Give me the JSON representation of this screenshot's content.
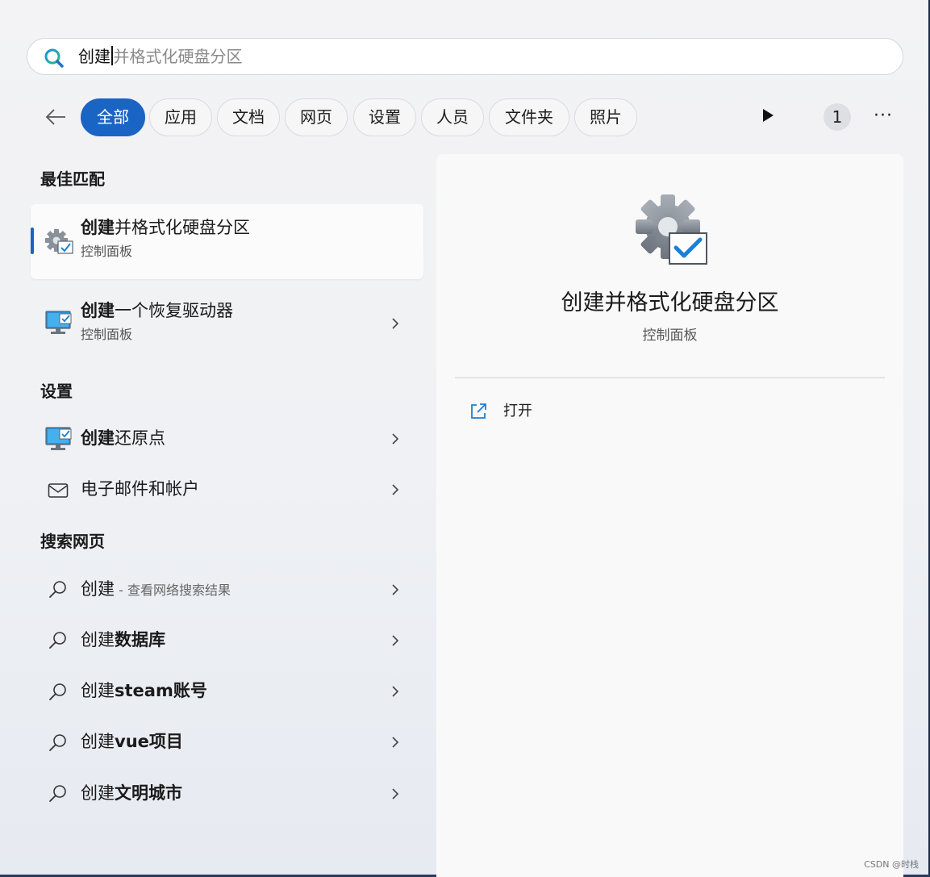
{
  "search": {
    "typed": "创建",
    "suggestion": "并格式化硬盘分区"
  },
  "filters": [
    "全部",
    "应用",
    "文档",
    "网页",
    "设置",
    "人员",
    "文件夹",
    "照片"
  ],
  "badge_count": "1",
  "more_label": "···",
  "best_match": {
    "heading": "最佳匹配",
    "items": [
      {
        "title": "创建并格式化硬盘分区",
        "bold_prefix": "创建",
        "rest": "并格式化硬盘分区",
        "subtitle": "控制面板"
      },
      {
        "title": "创建一个恢复驱动器",
        "bold_prefix": "创建",
        "rest": "一个恢复驱动器",
        "subtitle": "控制面板"
      }
    ]
  },
  "settings": {
    "heading": "设置",
    "items": [
      {
        "bold_prefix": "创建",
        "rest": "还原点"
      },
      {
        "bold_prefix": "",
        "rest": "电子邮件和帐户"
      }
    ]
  },
  "web": {
    "heading": "搜索网页",
    "items": [
      {
        "plain": "创建",
        "bold": "",
        "suffix": " - 查看网络搜索结果"
      },
      {
        "plain": "创建",
        "bold": "数据库",
        "suffix": ""
      },
      {
        "plain": "创建",
        "bold": "steam账号",
        "suffix": ""
      },
      {
        "plain": "创建",
        "bold": "vue项目",
        "suffix": ""
      },
      {
        "plain": "创建",
        "bold": "文明城市",
        "suffix": ""
      }
    ]
  },
  "preview": {
    "title": "创建并格式化硬盘分区",
    "subtitle": "控制面板",
    "action": "打开"
  },
  "watermark": "CSDN @时栈",
  "colors": {
    "accent": "#1a64c4"
  }
}
